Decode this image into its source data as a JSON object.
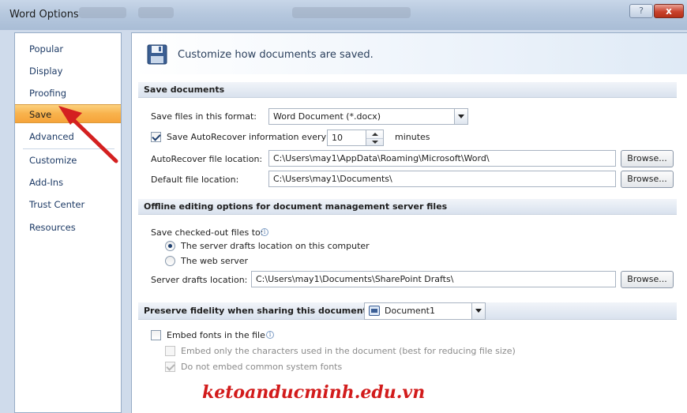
{
  "window": {
    "title": "Word Options",
    "help_glyph": "?",
    "close_glyph": "x"
  },
  "sidebar": {
    "items": [
      {
        "label": "Popular"
      },
      {
        "label": "Display"
      },
      {
        "label": "Proofing"
      },
      {
        "label": "Save",
        "selected": true
      },
      {
        "label": "Advanced"
      },
      {
        "label": "Customize"
      },
      {
        "label": "Add-Ins"
      },
      {
        "label": "Trust Center"
      },
      {
        "label": "Resources"
      }
    ]
  },
  "header": {
    "title": "Customize how documents are saved."
  },
  "save_documents": {
    "section_title": "Save documents",
    "format_label": "Save files in this format:",
    "format_value": "Word Document (*.docx)",
    "autorecover_checkbox_label": "Save AutoRecover information every",
    "autorecover_checked": true,
    "autorecover_minutes": "10",
    "minutes_label": "minutes",
    "autorecover_location_label": "AutoRecover file location:",
    "autorecover_location_value": "C:\\Users\\may1\\AppData\\Roaming\\Microsoft\\Word\\",
    "default_location_label": "Default file location:",
    "default_location_value": "C:\\Users\\may1\\Documents\\",
    "browse_label": "Browse..."
  },
  "offline": {
    "section_title": "Offline editing options for document management server files",
    "checked_out_label": "Save checked-out files to:",
    "option_server_drafts": "The server drafts location on this computer",
    "option_web_server": "The web server",
    "selected_option": "server_drafts",
    "server_drafts_label": "Server drafts location:",
    "server_drafts_value": "C:\\Users\\may1\\Documents\\SharePoint Drafts\\",
    "browse_label": "Browse..."
  },
  "fidelity": {
    "section_title": "Preserve fidelity when sharing this document:",
    "document_value": "Document1",
    "embed_fonts_label": "Embed fonts in the file",
    "embed_fonts_checked": false,
    "embed_chars_label": "Embed only the characters used in the document (best for reducing file size)",
    "embed_chars_checked": false,
    "no_common_fonts_label": "Do not embed common system fonts",
    "no_common_fonts_checked": true
  },
  "watermark": {
    "text": "ketoanducminh.edu.vn"
  },
  "colors": {
    "selected_nav": "#f8b24c",
    "arrow": "#d42020",
    "watermark": "#d21b1b"
  }
}
